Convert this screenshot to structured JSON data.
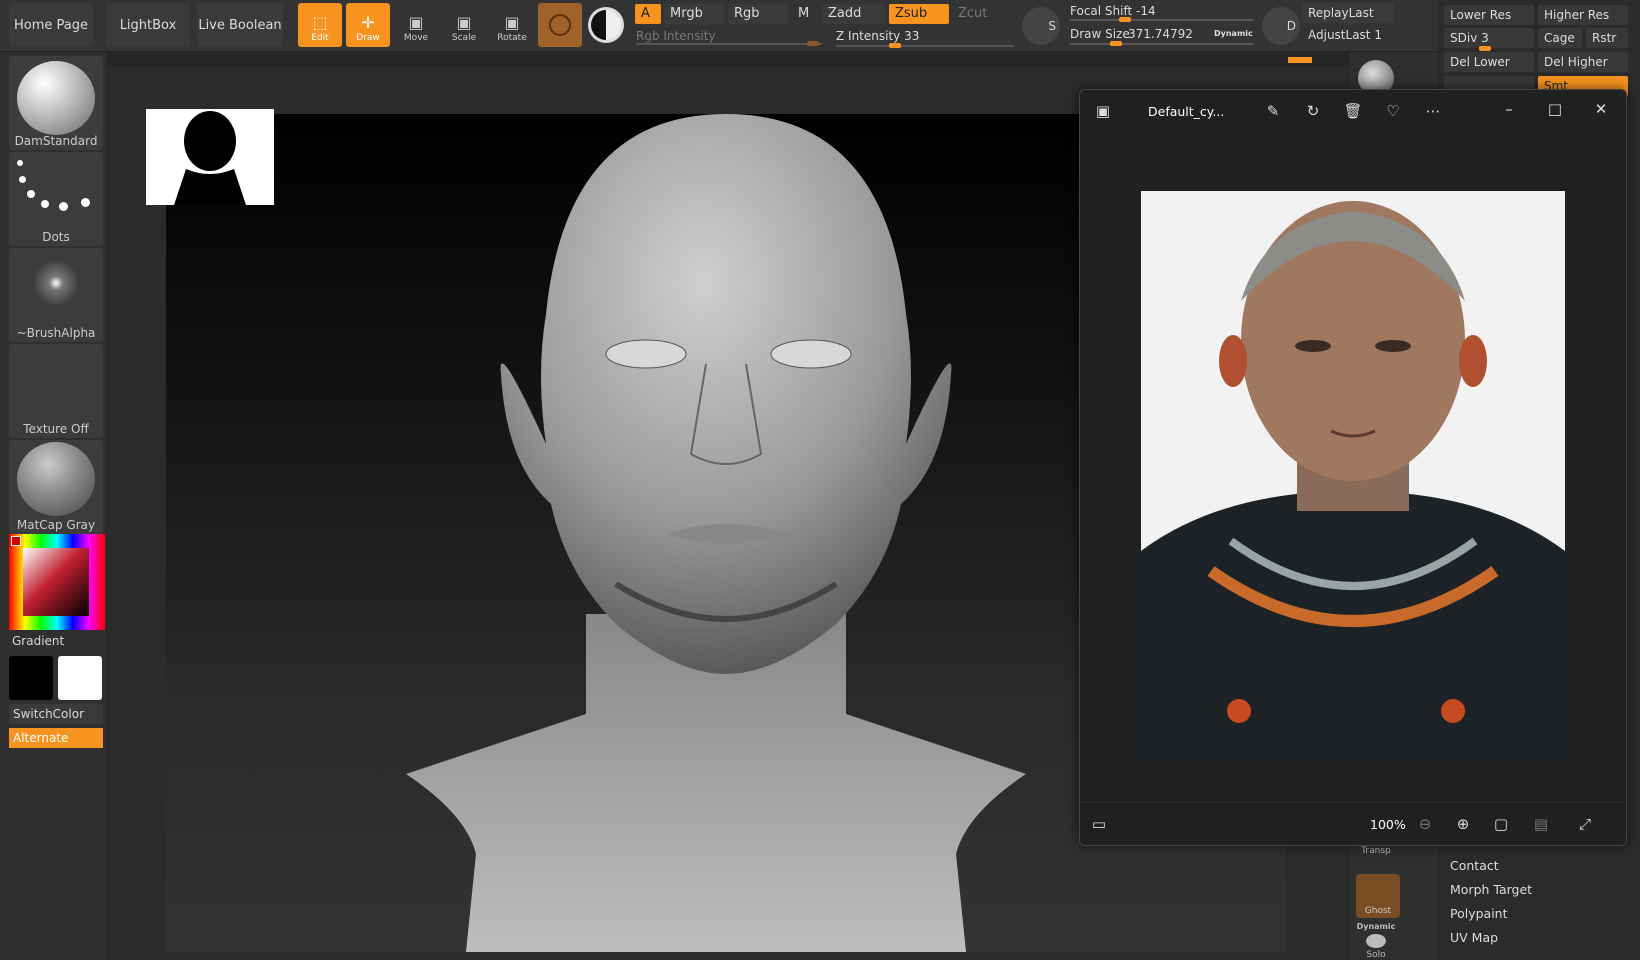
{
  "topbar": {
    "home_page": "Home Page",
    "lightbox": "LightBox",
    "live_boolean": "Live Boolean",
    "tools": {
      "edit": "Edit",
      "draw": "Draw",
      "move": "Move",
      "scale": "Scale",
      "rotate": "Rotate"
    },
    "a_label": "A",
    "mrgb": "Mrgb",
    "rgb": "Rgb",
    "m": "M",
    "zadd": "Zadd",
    "zsub": "Zsub",
    "zcut": "Zcut",
    "rgb_intensity": "Rgb Intensity",
    "z_intensity": "Z Intensity 33",
    "focal_shift": "Focal Shift -14",
    "draw_size_label": "Draw Size",
    "draw_size_value": "371.74792",
    "dynamic": "Dynamic",
    "replay_last": "ReplayLast",
    "adjust_last": "AdjustLast 1",
    "s_label": "S",
    "d_label": "D",
    "focal_shift_level": 0.3,
    "draw_size_level": 0.25,
    "z_intensity_level": 0.33,
    "rgb_intensity_level": 0.95
  },
  "leftpanel": {
    "brush": "DamStandard",
    "stroke": "Dots",
    "alpha": "~BrushAlpha",
    "texture": "Texture Off",
    "material": "MatCap Gray",
    "gradient": "Gradient",
    "switch_color": "SwitchColor",
    "alternate": "Alternate"
  },
  "rightpanel": {
    "lower_res": "Lower Res",
    "higher_res": "Higher Res",
    "sdiv": "SDiv 3",
    "cage": "Cage",
    "rstr": "Rstr",
    "del_lower": "Del Lower",
    "del_higher": "Del Higher",
    "smt": "Smt",
    "list": [
      "Contact",
      "Morph Target",
      "Polypaint",
      "UV Map"
    ],
    "sdiv_level": 0.45
  },
  "midstrip": {
    "transp": "Transp",
    "ghost": "Ghost",
    "dynamic": "Dynamic",
    "solo": "Solo"
  },
  "viewer": {
    "title": "Default_cy...",
    "zoom": "100%"
  },
  "colors": {
    "accent": "#f7931e",
    "panel": "#2f2f2f"
  }
}
